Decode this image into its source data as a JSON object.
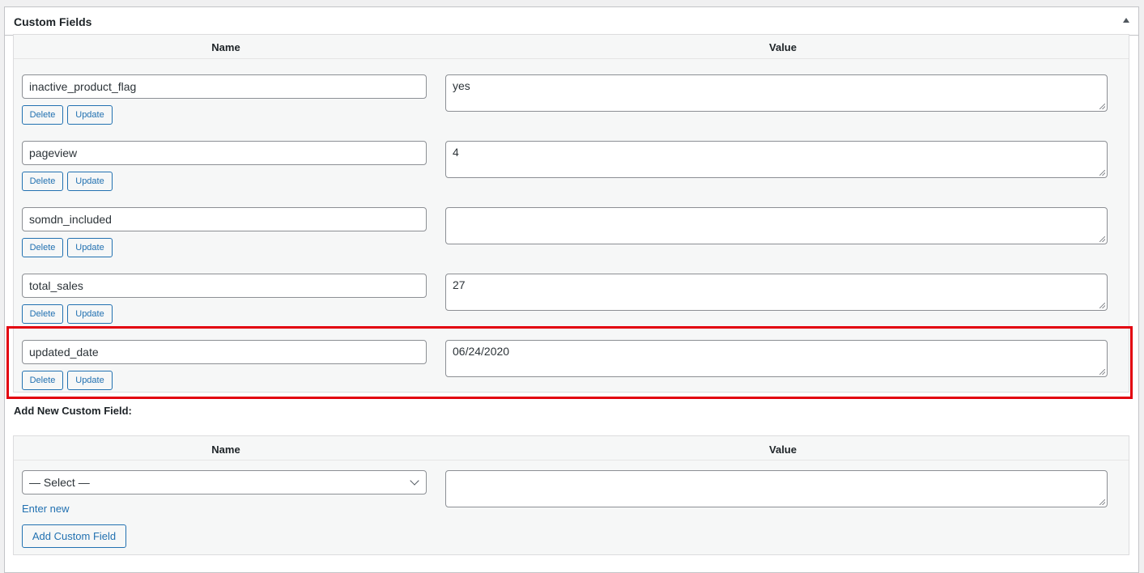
{
  "panel": {
    "title": "Custom Fields",
    "toggle_icon": "triangle-up-icon"
  },
  "table": {
    "name_header": "Name",
    "value_header": "Value"
  },
  "rows": [
    {
      "key": "inactive_product_flag",
      "value": "yes",
      "delete_label": "Delete",
      "update_label": "Update"
    },
    {
      "key": "pageview",
      "value": "4",
      "delete_label": "Delete",
      "update_label": "Update"
    },
    {
      "key": "somdn_included",
      "value": "",
      "delete_label": "Delete",
      "update_label": "Update"
    },
    {
      "key": "total_sales",
      "value": "27",
      "delete_label": "Delete",
      "update_label": "Update"
    },
    {
      "key": "updated_date",
      "value": "06/24/2020",
      "delete_label": "Delete",
      "update_label": "Update"
    }
  ],
  "highlight": {
    "row": 4,
    "color": "#e2000f"
  },
  "add_new": {
    "heading": "Add New Custom Field:",
    "name_header": "Name",
    "value_header": "Value",
    "select_value": "— Select —",
    "enter_new_label": "Enter new",
    "button_label": "Add Custom Field"
  },
  "colors": {
    "accent": "#2271b1",
    "border": "#8c8f94",
    "table_bg": "#f6f7f7"
  }
}
